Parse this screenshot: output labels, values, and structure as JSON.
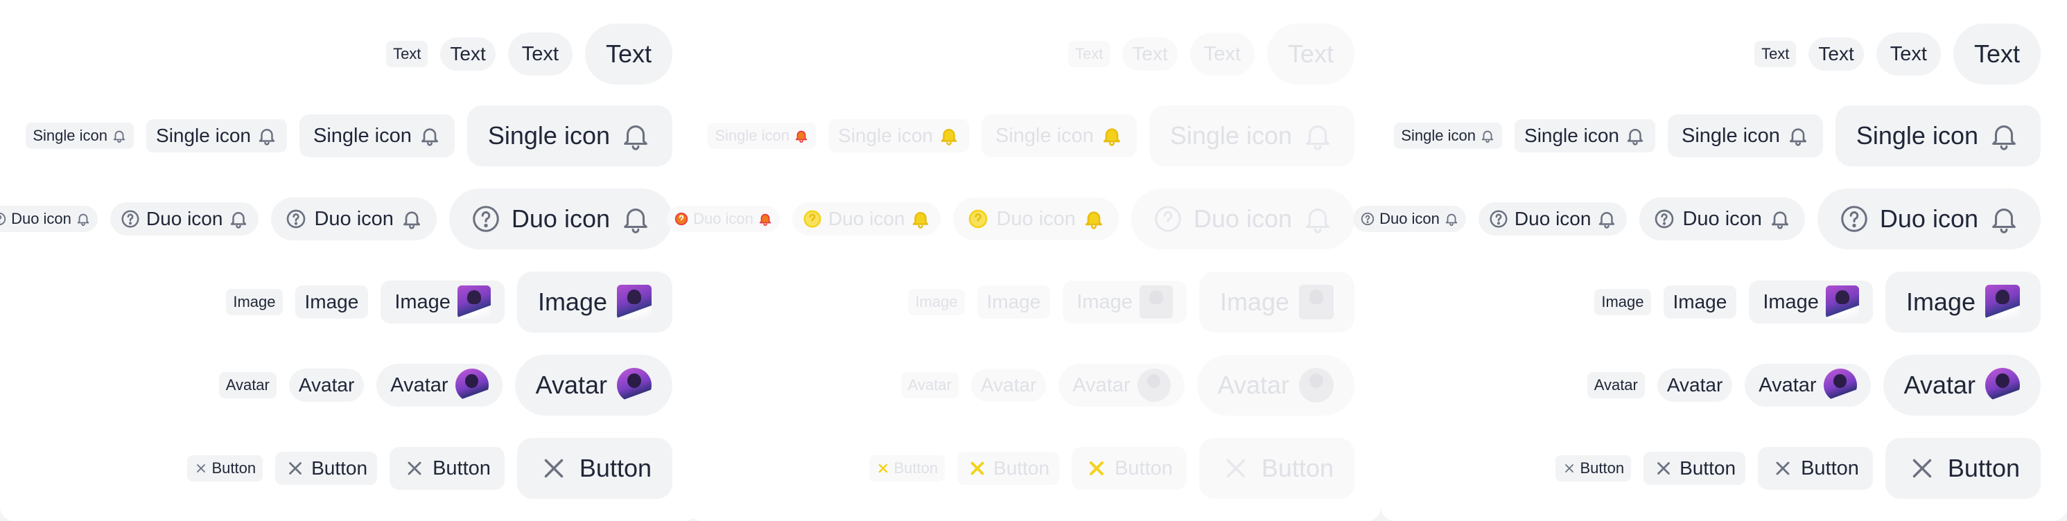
{
  "colors": {
    "chip_background": "#f2f3f5",
    "text": "#1f2637",
    "icon": "#6b7180",
    "disabled_text": "#dfe1e6",
    "warning_yellow": "#f4d21b",
    "warning_orange": "#f07b1c",
    "danger_red": "#e83d3d"
  },
  "labels": {
    "text": "Text",
    "single_icon": "Single icon",
    "duo_icon": "Duo icon",
    "image": "Image",
    "avatar": "Avatar",
    "button": "Button"
  },
  "icons": {
    "bell": "bell-icon",
    "help": "help-circle-icon",
    "close": "close-icon"
  },
  "panels": [
    {
      "state": "default"
    },
    {
      "state": "disabled"
    },
    {
      "state": "default"
    }
  ]
}
